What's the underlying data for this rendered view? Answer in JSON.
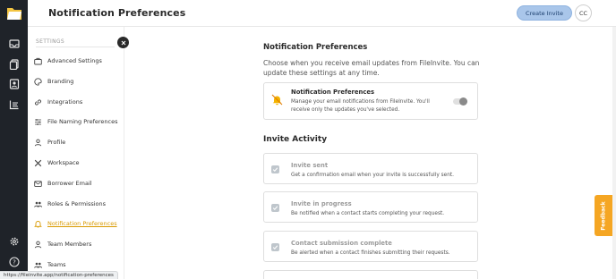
{
  "header": {
    "title": "Notification Preferences",
    "create_button": "Create Invite",
    "avatar_initials": "CC"
  },
  "rail": {
    "icons": [
      "logo-icon",
      "inbox-icon",
      "documents-icon",
      "contacts-icon",
      "reports-icon",
      "settings-icon",
      "help-icon"
    ]
  },
  "sidebar": {
    "heading": "SETTINGS",
    "items": [
      {
        "label": "Advanced Settings",
        "icon": "briefcase-icon"
      },
      {
        "label": "Branding",
        "icon": "palette-icon"
      },
      {
        "label": "Integrations",
        "icon": "link-icon"
      },
      {
        "label": "File Naming Preferences",
        "icon": "sliders-icon"
      },
      {
        "label": "Profile",
        "icon": "user-icon"
      },
      {
        "label": "Workspace",
        "icon": "tools-icon"
      },
      {
        "label": "Borrower Email",
        "icon": "mail-icon"
      },
      {
        "label": "Roles & Permissions",
        "icon": "users-icon"
      },
      {
        "label": "Notification Preferences",
        "icon": "bell-icon"
      },
      {
        "label": "Team Members",
        "icon": "user-icon"
      },
      {
        "label": "Teams",
        "icon": "users-icon"
      }
    ],
    "active_index": 8
  },
  "main": {
    "section_title": "Notification Preferences",
    "section_desc": "Choose when you receive email updates from FileInvite. You can update these settings at any time.",
    "pref_card": {
      "title": "Notification Preferences",
      "desc": "Manage your email notifications from FileInvite. You'll receive only the updates you've selected.",
      "toggle_on": false
    },
    "invite_activity_title": "Invite Activity",
    "activities": [
      {
        "title": "Invite sent",
        "desc": "Get a confirmation email when your invite is successfully sent.",
        "checked": true
      },
      {
        "title": "Invite in progress",
        "desc": "Be notified when a contact starts completing your request.",
        "checked": true
      },
      {
        "title": "Contact submission complete",
        "desc": "Be alerted when a contact finishes submitting their requests.",
        "checked": true
      }
    ]
  },
  "feedback_label": "Feedback",
  "status_url": "https://fileinvite.app/notification-preferences",
  "colors": {
    "rail": "#1f2329",
    "accent": "#d99a00",
    "feedback": "#f5a623",
    "create_button": "#a9c6ea"
  }
}
